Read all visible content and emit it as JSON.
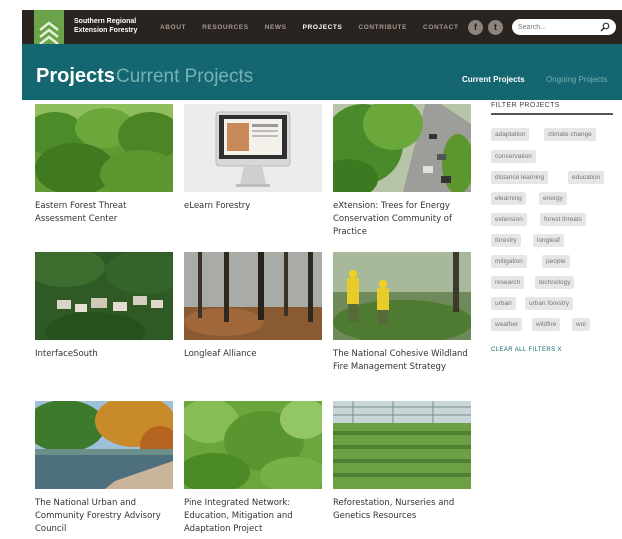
{
  "brand": {
    "line1": "Southern Regional",
    "line2": "Extension Forestry"
  },
  "nav": [
    "ABOUT",
    "RESOURCES",
    "NEWS",
    "PROJECTS",
    "CONTRIBUTE",
    "CONTACT"
  ],
  "social": {
    "facebook": "f",
    "twitter": "t"
  },
  "search": {
    "placeholder": "Search..."
  },
  "header": {
    "title": "Projects",
    "subtitle": "Current Projects",
    "tabs": [
      "Current Projects",
      "Ongoing Projects"
    ]
  },
  "projects": [
    {
      "title": "Eastern Forest Threat Assessment Center",
      "image": "kudzu-covered-trees"
    },
    {
      "title": "eLearn Forestry",
      "image": "imac-with-screen"
    },
    {
      "title": "eXtension: Trees for Energy Conservation Community of Practice",
      "image": "tree-lined-street"
    },
    {
      "title": "InterfaceSouth",
      "image": "houses-in-forest-aerial"
    },
    {
      "title": "Longleaf Alliance",
      "image": "pine-forest-smoke"
    },
    {
      "title": "The National Cohesive Wildland Fire Management Strategy",
      "image": "firefighters-in-yellow"
    },
    {
      "title": "The National Urban and Community Forestry Advisory Council",
      "image": "autumn-lake"
    },
    {
      "title": "Pine Integrated Network: Education, Mitigation and Adaptation Project",
      "image": "pine-canopy"
    },
    {
      "title": "Reforestation, Nurseries and Genetics Resources",
      "image": "seedling-greenhouse"
    }
  ],
  "filters": {
    "heading": "FILTER PROJECTS",
    "tags": [
      "adaptation",
      "climate change",
      "conservation",
      "distance learning",
      "education",
      "elearning",
      "energy",
      "extension",
      "forest threats",
      "forestry",
      "longleaf",
      "mitigation",
      "people",
      "research",
      "technology",
      "urban",
      "urban forestry",
      "weather",
      "wildfire",
      "wui"
    ],
    "clear": "CLEAR ALL FILTERS X"
  },
  "colors": {
    "topbar": "#2a2421",
    "band": "#146670",
    "logo": "#6aa34a"
  }
}
